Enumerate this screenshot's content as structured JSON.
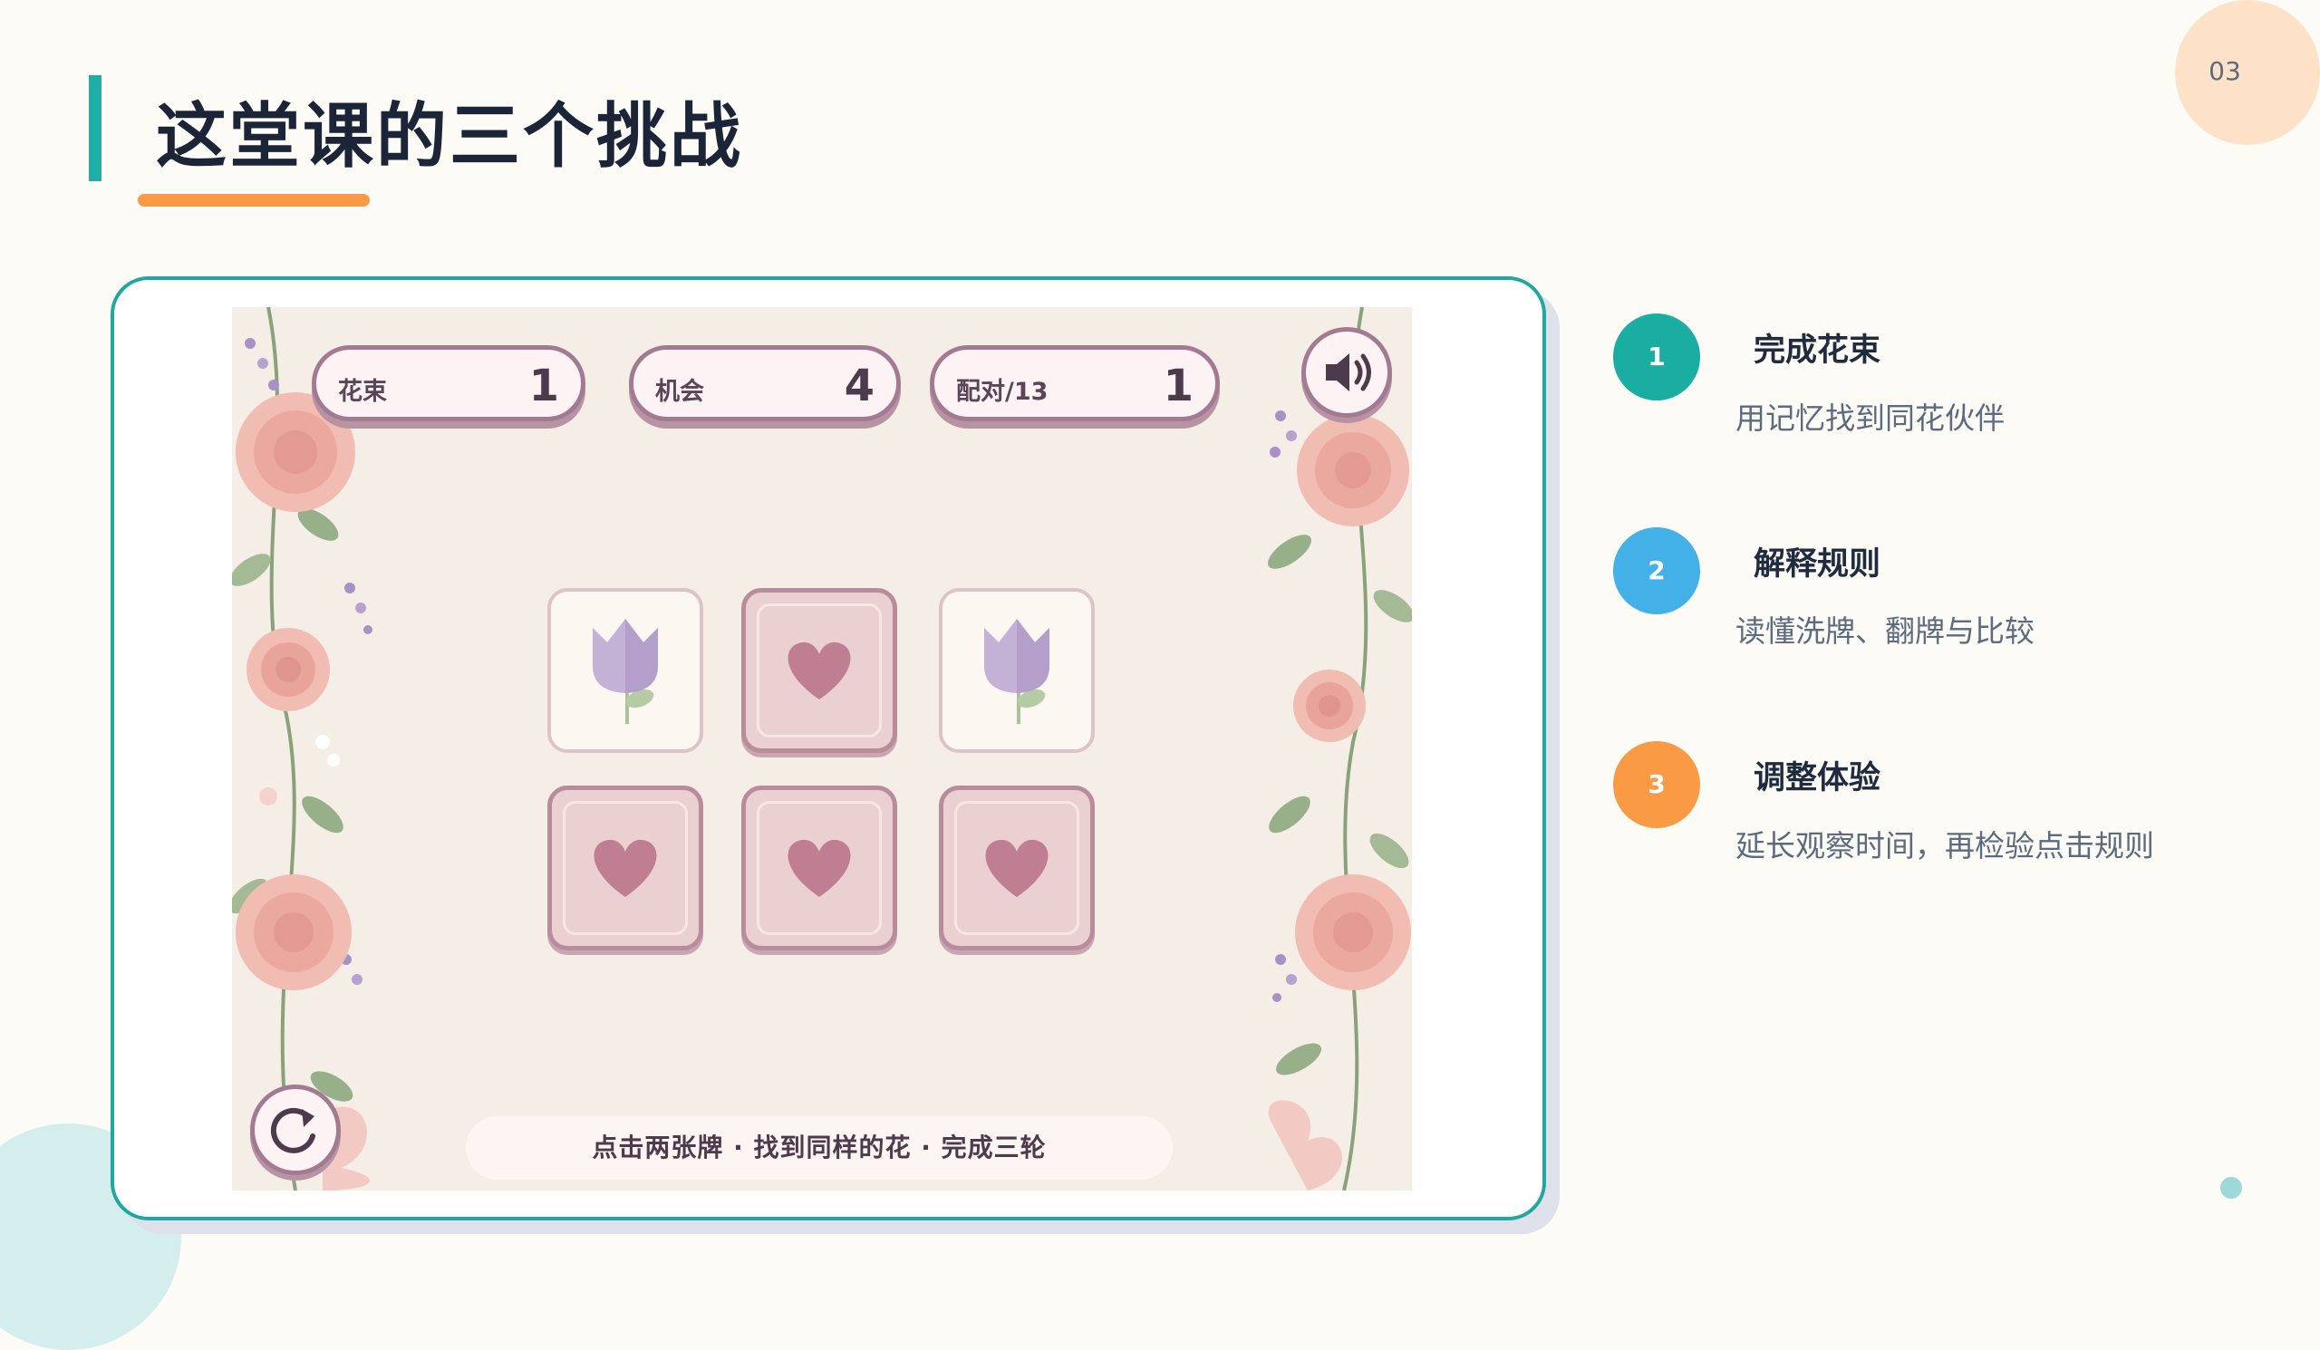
{
  "page": {
    "number": "03"
  },
  "slide": {
    "title": "这堂课的三个挑战"
  },
  "game": {
    "stats": [
      {
        "label": "花束",
        "value": "1"
      },
      {
        "label": "机会",
        "value": "4"
      },
      {
        "label": "配对/13",
        "value": "1"
      }
    ],
    "sound_icon": "speaker-icon",
    "restart_icon": "restart-icon",
    "cards": [
      {
        "state": "face-up",
        "symbol": "tulip"
      },
      {
        "state": "face-down",
        "symbol": "heart"
      },
      {
        "state": "face-up",
        "symbol": "tulip"
      },
      {
        "state": "face-down",
        "symbol": "heart"
      },
      {
        "state": "face-down",
        "symbol": "heart"
      },
      {
        "state": "face-down",
        "symbol": "heart"
      }
    ],
    "hint": "点击两张牌 · 找到同样的花 · 完成三轮"
  },
  "challenges": [
    {
      "number": "1",
      "title": "完成花束",
      "desc": "用记忆找到同花伙伴",
      "color": "#1aaea2"
    },
    {
      "number": "2",
      "title": "解释规则",
      "desc": "读懂洗牌、翻牌与比较",
      "color": "#43b1e8"
    },
    {
      "number": "3",
      "title": "调整体验",
      "desc": "延长观察时间，再检验点击规则",
      "color": "#fb9a45"
    }
  ],
  "colors": {
    "teal": "#20ada4",
    "orange": "#fa9a46",
    "card_heart": "#c07e92",
    "tulip": "#c4b2d6"
  }
}
